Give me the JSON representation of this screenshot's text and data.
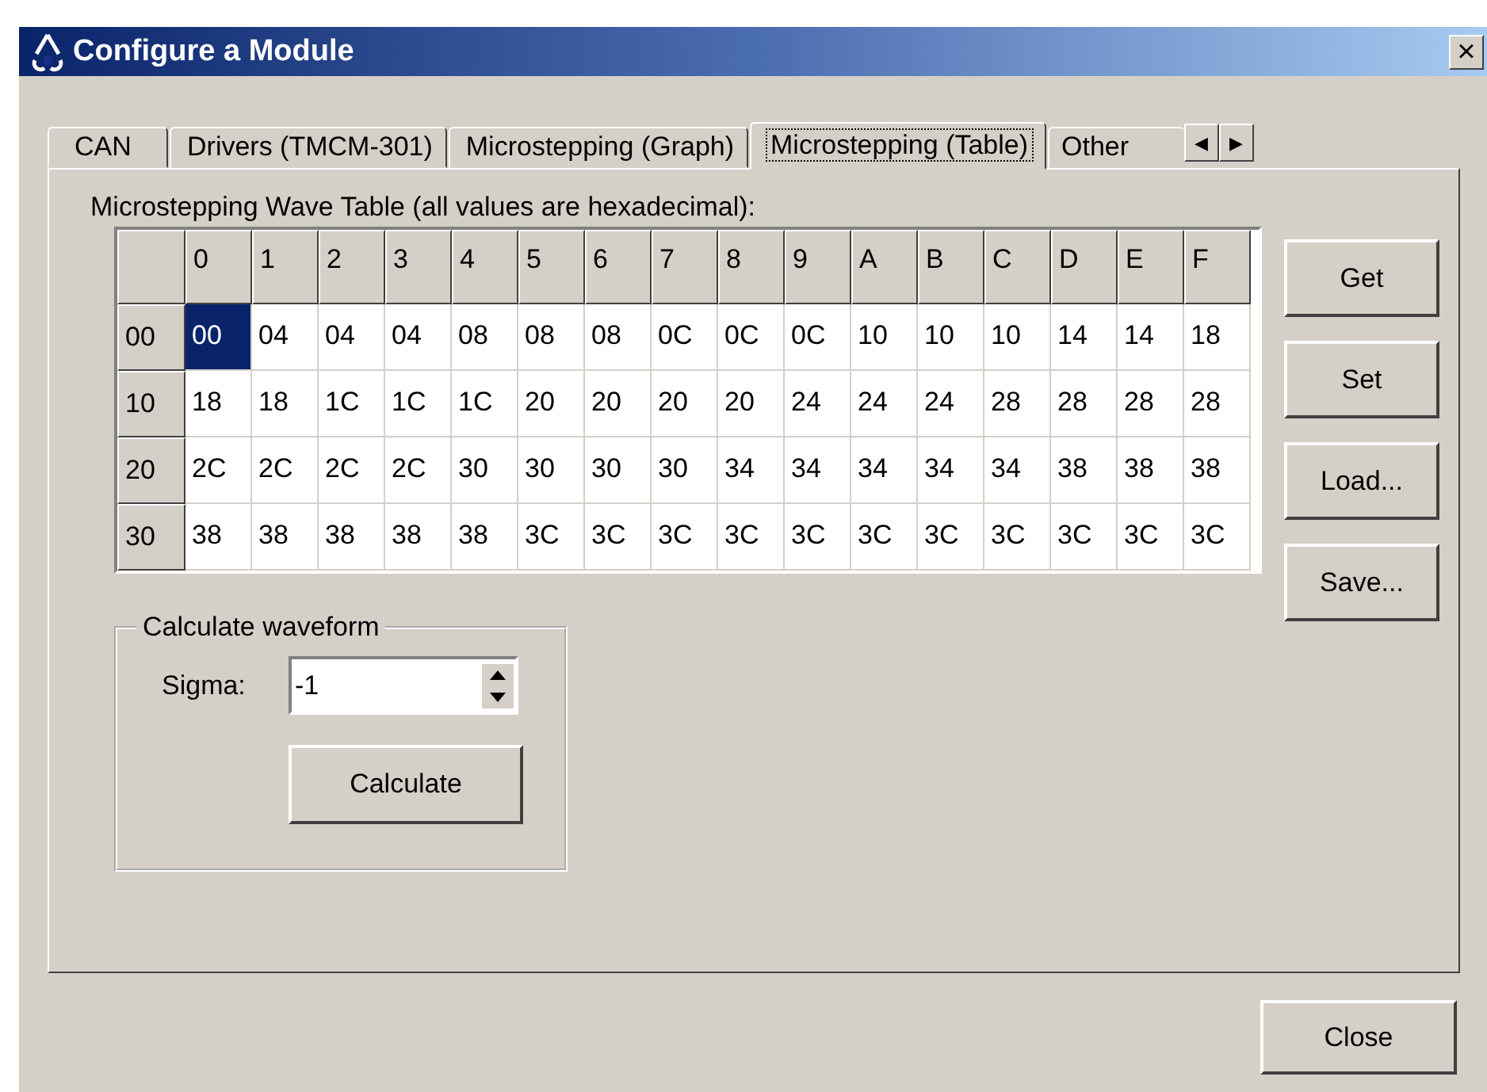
{
  "window": {
    "title": "Configure a Module",
    "close": "×"
  },
  "tabs": [
    {
      "label": "CAN",
      "selected": false
    },
    {
      "label": "Drivers (TMCM-301)",
      "selected": false
    },
    {
      "label": "Microstepping (Graph)",
      "selected": false
    },
    {
      "label": "Microstepping (Table)",
      "selected": true
    },
    {
      "label": "Other",
      "selected": false
    }
  ],
  "tab_scroll": [
    "◀",
    "▶"
  ],
  "table_caption": "Microstepping Wave Table (all values are hexadecimal):",
  "table": {
    "columns": [
      "0",
      "1",
      "2",
      "3",
      "4",
      "5",
      "6",
      "7",
      "8",
      "9",
      "A",
      "B",
      "C",
      "D",
      "E",
      "F"
    ],
    "rows": [
      {
        "header": "00",
        "cells": [
          {
            "text": "00",
            "selected": true
          },
          {
            "text": "04",
            "selected": false
          },
          {
            "text": "04",
            "selected": false
          },
          {
            "text": "04",
            "selected": false
          },
          {
            "text": "08",
            "selected": false
          },
          {
            "text": "08",
            "selected": false
          },
          {
            "text": "08",
            "selected": false
          },
          {
            "text": "0C",
            "selected": false
          },
          {
            "text": "0C",
            "selected": false
          },
          {
            "text": "0C",
            "selected": false
          },
          {
            "text": "10",
            "selected": false
          },
          {
            "text": "10",
            "selected": false
          },
          {
            "text": "10",
            "selected": false
          },
          {
            "text": "14",
            "selected": false
          },
          {
            "text": "14",
            "selected": false
          },
          {
            "text": "18",
            "selected": false
          }
        ]
      },
      {
        "header": "10",
        "cells": [
          {
            "text": "18",
            "selected": false
          },
          {
            "text": "18",
            "selected": false
          },
          {
            "text": "1C",
            "selected": false
          },
          {
            "text": "1C",
            "selected": false
          },
          {
            "text": "1C",
            "selected": false
          },
          {
            "text": "20",
            "selected": false
          },
          {
            "text": "20",
            "selected": false
          },
          {
            "text": "20",
            "selected": false
          },
          {
            "text": "20",
            "selected": false
          },
          {
            "text": "24",
            "selected": false
          },
          {
            "text": "24",
            "selected": false
          },
          {
            "text": "24",
            "selected": false
          },
          {
            "text": "28",
            "selected": false
          },
          {
            "text": "28",
            "selected": false
          },
          {
            "text": "28",
            "selected": false
          },
          {
            "text": "28",
            "selected": false
          }
        ]
      },
      {
        "header": "20",
        "cells": [
          {
            "text": "2C",
            "selected": false
          },
          {
            "text": "2C",
            "selected": false
          },
          {
            "text": "2C",
            "selected": false
          },
          {
            "text": "2C",
            "selected": false
          },
          {
            "text": "30",
            "selected": false
          },
          {
            "text": "30",
            "selected": false
          },
          {
            "text": "30",
            "selected": false
          },
          {
            "text": "30",
            "selected": false
          },
          {
            "text": "34",
            "selected": false
          },
          {
            "text": "34",
            "selected": false
          },
          {
            "text": "34",
            "selected": false
          },
          {
            "text": "34",
            "selected": false
          },
          {
            "text": "34",
            "selected": false
          },
          {
            "text": "38",
            "selected": false
          },
          {
            "text": "38",
            "selected": false
          },
          {
            "text": "38",
            "selected": false
          }
        ]
      },
      {
        "header": "30",
        "cells": [
          {
            "text": "38",
            "selected": false
          },
          {
            "text": "38",
            "selected": false
          },
          {
            "text": "38",
            "selected": false
          },
          {
            "text": "38",
            "selected": false
          },
          {
            "text": "38",
            "selected": false
          },
          {
            "text": "3C",
            "selected": false
          },
          {
            "text": "3C",
            "selected": false
          },
          {
            "text": "3C",
            "selected": false
          },
          {
            "text": "3C",
            "selected": false
          },
          {
            "text": "3C",
            "selected": false
          },
          {
            "text": "3C",
            "selected": false
          },
          {
            "text": "3C",
            "selected": false
          },
          {
            "text": "3C",
            "selected": false
          },
          {
            "text": "3C",
            "selected": false
          },
          {
            "text": "3C",
            "selected": false
          },
          {
            "text": "3C",
            "selected": false
          }
        ]
      }
    ]
  },
  "side_buttons": [
    "Get",
    "Set",
    "Load...",
    "Save..."
  ],
  "waveform": {
    "title": "Calculate waveform",
    "sigma_label": "Sigma:",
    "sigma_value": "-1",
    "button": "Calculate"
  },
  "close_button": "Close"
}
